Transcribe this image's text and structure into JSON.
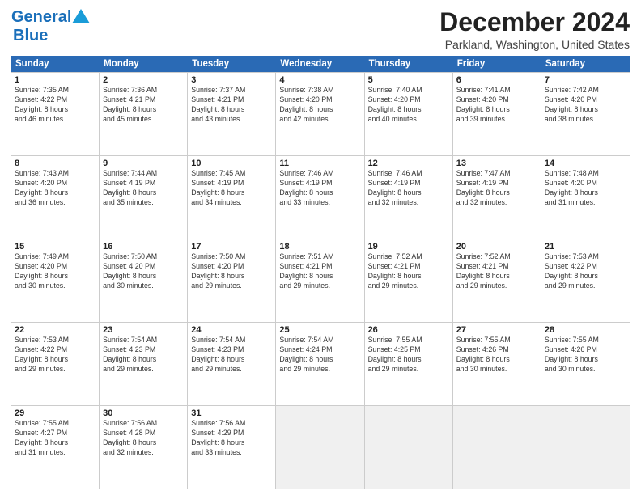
{
  "logo": {
    "line1": "General",
    "line2": "Blue"
  },
  "title": "December 2024",
  "subtitle": "Parkland, Washington, United States",
  "days": [
    "Sunday",
    "Monday",
    "Tuesday",
    "Wednesday",
    "Thursday",
    "Friday",
    "Saturday"
  ],
  "weeks": [
    [
      {
        "day": "1",
        "sun": "7:35 AM",
        "set": "4:22 PM",
        "dl": "8 hours and 46 minutes."
      },
      {
        "day": "2",
        "sun": "7:36 AM",
        "set": "4:21 PM",
        "dl": "8 hours and 45 minutes."
      },
      {
        "day": "3",
        "sun": "7:37 AM",
        "set": "4:21 PM",
        "dl": "8 hours and 43 minutes."
      },
      {
        "day": "4",
        "sun": "7:38 AM",
        "set": "4:20 PM",
        "dl": "8 hours and 42 minutes."
      },
      {
        "day": "5",
        "sun": "7:40 AM",
        "set": "4:20 PM",
        "dl": "8 hours and 40 minutes."
      },
      {
        "day": "6",
        "sun": "7:41 AM",
        "set": "4:20 PM",
        "dl": "8 hours and 39 minutes."
      },
      {
        "day": "7",
        "sun": "7:42 AM",
        "set": "4:20 PM",
        "dl": "8 hours and 38 minutes."
      }
    ],
    [
      {
        "day": "8",
        "sun": "7:43 AM",
        "set": "4:20 PM",
        "dl": "8 hours and 36 minutes."
      },
      {
        "day": "9",
        "sun": "7:44 AM",
        "set": "4:19 PM",
        "dl": "8 hours and 35 minutes."
      },
      {
        "day": "10",
        "sun": "7:45 AM",
        "set": "4:19 PM",
        "dl": "8 hours and 34 minutes."
      },
      {
        "day": "11",
        "sun": "7:46 AM",
        "set": "4:19 PM",
        "dl": "8 hours and 33 minutes."
      },
      {
        "day": "12",
        "sun": "7:46 AM",
        "set": "4:19 PM",
        "dl": "8 hours and 32 minutes."
      },
      {
        "day": "13",
        "sun": "7:47 AM",
        "set": "4:19 PM",
        "dl": "8 hours and 32 minutes."
      },
      {
        "day": "14",
        "sun": "7:48 AM",
        "set": "4:20 PM",
        "dl": "8 hours and 31 minutes."
      }
    ],
    [
      {
        "day": "15",
        "sun": "7:49 AM",
        "set": "4:20 PM",
        "dl": "8 hours and 30 minutes."
      },
      {
        "day": "16",
        "sun": "7:50 AM",
        "set": "4:20 PM",
        "dl": "8 hours and 30 minutes."
      },
      {
        "day": "17",
        "sun": "7:50 AM",
        "set": "4:20 PM",
        "dl": "8 hours and 29 minutes."
      },
      {
        "day": "18",
        "sun": "7:51 AM",
        "set": "4:21 PM",
        "dl": "8 hours and 29 minutes."
      },
      {
        "day": "19",
        "sun": "7:52 AM",
        "set": "4:21 PM",
        "dl": "8 hours and 29 minutes."
      },
      {
        "day": "20",
        "sun": "7:52 AM",
        "set": "4:21 PM",
        "dl": "8 hours and 29 minutes."
      },
      {
        "day": "21",
        "sun": "7:53 AM",
        "set": "4:22 PM",
        "dl": "8 hours and 29 minutes."
      }
    ],
    [
      {
        "day": "22",
        "sun": "7:53 AM",
        "set": "4:22 PM",
        "dl": "8 hours and 29 minutes."
      },
      {
        "day": "23",
        "sun": "7:54 AM",
        "set": "4:23 PM",
        "dl": "8 hours and 29 minutes."
      },
      {
        "day": "24",
        "sun": "7:54 AM",
        "set": "4:23 PM",
        "dl": "8 hours and 29 minutes."
      },
      {
        "day": "25",
        "sun": "7:54 AM",
        "set": "4:24 PM",
        "dl": "8 hours and 29 minutes."
      },
      {
        "day": "26",
        "sun": "7:55 AM",
        "set": "4:25 PM",
        "dl": "8 hours and 29 minutes."
      },
      {
        "day": "27",
        "sun": "7:55 AM",
        "set": "4:26 PM",
        "dl": "8 hours and 30 minutes."
      },
      {
        "day": "28",
        "sun": "7:55 AM",
        "set": "4:26 PM",
        "dl": "8 hours and 30 minutes."
      }
    ],
    [
      {
        "day": "29",
        "sun": "7:55 AM",
        "set": "4:27 PM",
        "dl": "8 hours and 31 minutes."
      },
      {
        "day": "30",
        "sun": "7:56 AM",
        "set": "4:28 PM",
        "dl": "8 hours and 32 minutes."
      },
      {
        "day": "31",
        "sun": "7:56 AM",
        "set": "4:29 PM",
        "dl": "8 hours and 33 minutes."
      },
      null,
      null,
      null,
      null
    ]
  ]
}
